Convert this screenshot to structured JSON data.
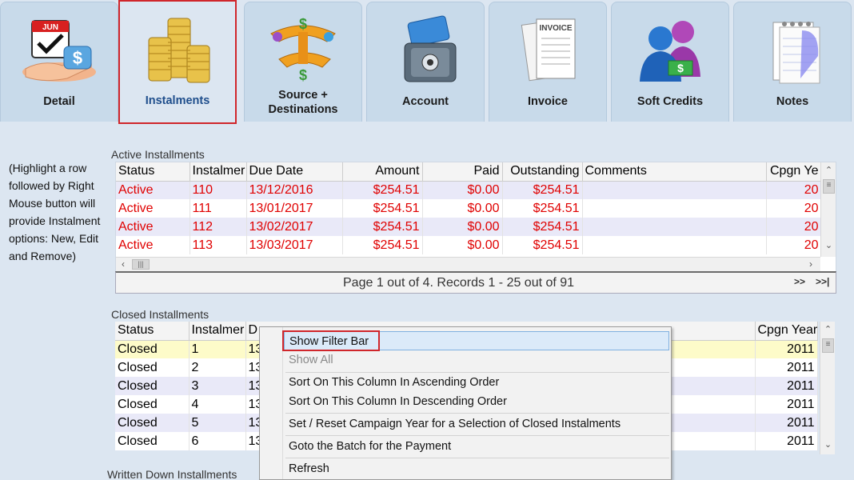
{
  "tabs": [
    {
      "label": "Detail",
      "icon": "calendar-money-hand-icon",
      "selected": false
    },
    {
      "label": "Instalments",
      "icon": "gold-coins-icon",
      "selected": true
    },
    {
      "label": "Source +\nDestinations",
      "icon": "money-scales-icon",
      "selected": false
    },
    {
      "label": "Account",
      "icon": "credit-card-safe-icon",
      "selected": false
    },
    {
      "label": "Invoice",
      "icon": "invoice-documents-icon",
      "selected": false
    },
    {
      "label": "Soft Credits",
      "icon": "people-money-icon",
      "selected": false
    },
    {
      "label": "Notes",
      "icon": "notepad-icon",
      "selected": false
    }
  ],
  "help_text": "(Highlight a row followed by Right Mouse button will provide Instalment options: New, Edit and Remove)",
  "active": {
    "title": "Active Installments",
    "columns": [
      "Status",
      "Instalmer",
      "Due Date",
      "Amount",
      "Paid",
      "Outstanding",
      "Comments",
      "Cpgn Ye"
    ],
    "rows": [
      [
        "Active",
        "110",
        "13/12/2016",
        "$254.51",
        "$0.00",
        "$254.51",
        "",
        "20"
      ],
      [
        "Active",
        "111",
        "13/01/2017",
        "$254.51",
        "$0.00",
        "$254.51",
        "",
        "20"
      ],
      [
        "Active",
        "112",
        "13/02/2017",
        "$254.51",
        "$0.00",
        "$254.51",
        "",
        "20"
      ],
      [
        "Active",
        "113",
        "13/03/2017",
        "$254.51",
        "$0.00",
        "$254.51",
        "",
        "20"
      ]
    ],
    "pager": {
      "info": "Page 1 out of 4.  Records 1 - 25 out of 91",
      "next": ">>",
      "last": ">>|"
    }
  },
  "closed": {
    "title": "Closed Installments",
    "columns": [
      "Status",
      "Instalmer",
      "D",
      "Cpgn Year"
    ],
    "rows": [
      [
        "Closed",
        "1",
        "13",
        "2011"
      ],
      [
        "Closed",
        "2",
        "13",
        "2011"
      ],
      [
        "Closed",
        "3",
        "13",
        "2011"
      ],
      [
        "Closed",
        "4",
        "13",
        "2011"
      ],
      [
        "Closed",
        "5",
        "13",
        "2011"
      ],
      [
        "Closed",
        "6",
        "13",
        "2011"
      ]
    ]
  },
  "written_down": {
    "title": "Written Down Installments"
  },
  "context_menu": {
    "items": [
      {
        "label": "Show Filter Bar",
        "highlighted": true,
        "disabled": false
      },
      {
        "label": "Show All",
        "highlighted": false,
        "disabled": true
      },
      {
        "label": "Sort On This Column In Ascending Order",
        "highlighted": false,
        "disabled": false
      },
      {
        "label": "Sort On This Column In Descending Order",
        "highlighted": false,
        "disabled": false
      },
      {
        "label": "Set / Reset Campaign Year for a Selection of Closed Instalments",
        "highlighted": false,
        "disabled": false
      },
      {
        "label": "Goto the Batch for the Payment",
        "highlighted": false,
        "disabled": false
      },
      {
        "label": "Refresh",
        "highlighted": false,
        "disabled": false
      }
    ]
  },
  "colors": {
    "active_text": "#e00000",
    "selected_tab_border": "#d0262b",
    "highlight_row": "#fdfbc9"
  }
}
